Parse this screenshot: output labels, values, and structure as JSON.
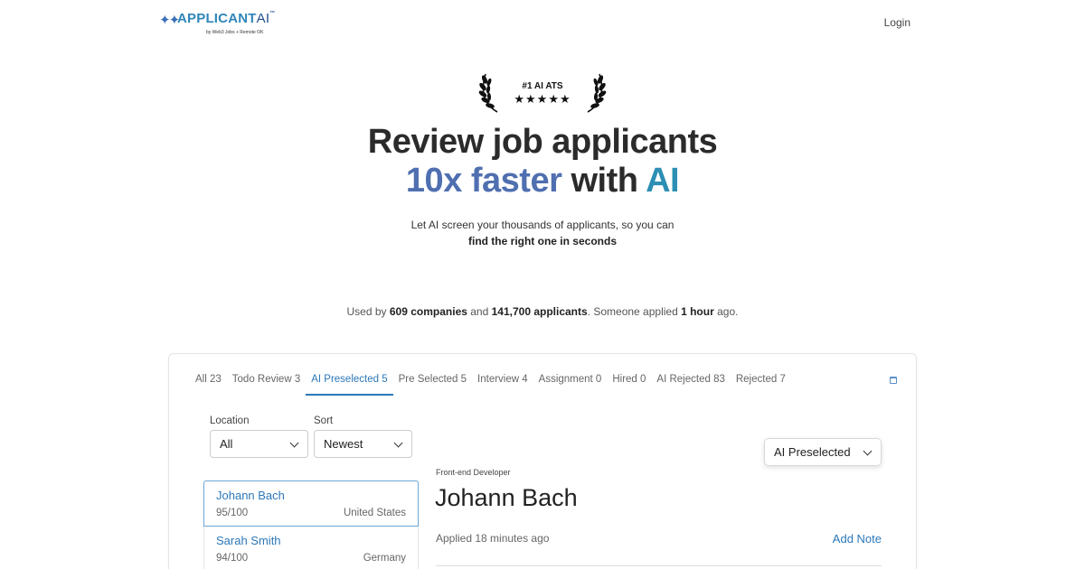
{
  "header": {
    "brand_name": "APPLICANT",
    "brand_ai": "AI",
    "brand_tm": "™",
    "brand_byline": "by Web3 Jobs + Remote OK",
    "login_label": "Login"
  },
  "award": {
    "title": "#1 AI ATS",
    "stars": "★★★★★"
  },
  "hero": {
    "line1": "Review job applicants",
    "line2_grad": "10x faster",
    "line2_mid": " with ",
    "line2_ai": "AI",
    "sub1": "Let AI screen your thousands of applicants, so you can",
    "sub2": "find the right one in seconds"
  },
  "stats": {
    "prefix": "Used by ",
    "companies": "609 companies",
    "mid": " and ",
    "applicants": "141,700 applicants",
    "mid2": ". Someone applied ",
    "time": "1 hour",
    "suffix": " ago."
  },
  "app": {
    "tabs": [
      {
        "label": "All 23"
      },
      {
        "label": "Todo Review 3"
      },
      {
        "label": "AI Preselected 5"
      },
      {
        "label": "Pre Selected 5"
      },
      {
        "label": "Interview 4"
      },
      {
        "label": "Assignment 0"
      },
      {
        "label": "Hired 0"
      },
      {
        "label": "AI Rejected 83"
      },
      {
        "label": "Rejected 7"
      }
    ],
    "active_tab": 2,
    "location_label": "Location",
    "location_value": "All",
    "sort_label": "Sort",
    "sort_value": "Newest",
    "status_select": "AI Preselected",
    "candidates": [
      {
        "name": "Johann Bach",
        "score": "95/100",
        "location": "United States"
      },
      {
        "name": "Sarah Smith",
        "score": "94/100",
        "location": "Germany"
      }
    ],
    "detail": {
      "role": "Front-end Developer",
      "name": "Johann Bach",
      "applied": "Applied 18 minutes ago",
      "add_note": "Add Note"
    }
  },
  "colors": {
    "accent": "#2c78b8",
    "gradient_text": "#4f6fb0",
    "ai_text": "#2c8fb3"
  }
}
